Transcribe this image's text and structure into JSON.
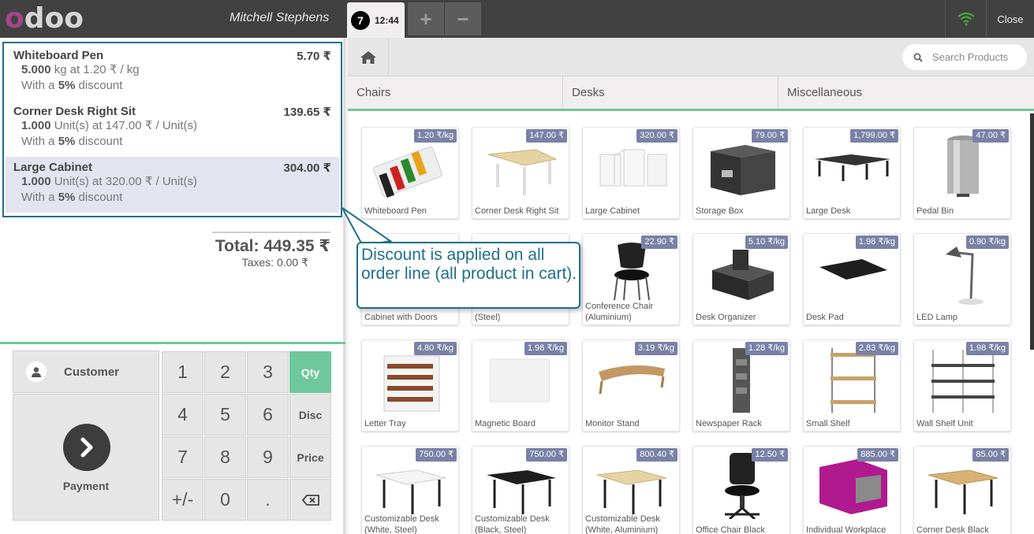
{
  "header": {
    "user": "Mitchell Stephens",
    "order_number": "7",
    "order_time": "12:44",
    "add_label": "+",
    "remove_label": "−",
    "close_label": "Close"
  },
  "order": {
    "lines": [
      {
        "name": "Whiteboard Pen",
        "price": "5.70 ₹",
        "qty": "5.000",
        "unit_text": " kg at 1.20 ₹ / kg",
        "disc_pre": "With a ",
        "disc": "5%",
        "disc_post": " discount"
      },
      {
        "name": "Corner Desk Right Sit",
        "price": "139.65 ₹",
        "qty": "1.000",
        "unit_text": " Unit(s) at 147.00 ₹ / Unit(s)",
        "disc_pre": "With a ",
        "disc": "5%",
        "disc_post": " discount"
      },
      {
        "name": "Large Cabinet",
        "price": "304.00 ₹",
        "qty": "1.000",
        "unit_text": " Unit(s) at 320.00 ₹ / Unit(s)",
        "disc_pre": "With a ",
        "disc": "5%",
        "disc_post": " discount"
      }
    ],
    "total": "Total: 449.35 ₹",
    "taxes": "Taxes: 0.00 ₹"
  },
  "keypad": {
    "customer_label": "Customer",
    "payment_label": "Payment",
    "keys": [
      "1",
      "2",
      "3",
      "4",
      "5",
      "6",
      "7",
      "8",
      "9",
      "+/-",
      "0",
      "."
    ],
    "modes": [
      "Qty",
      "Disc",
      "Price"
    ]
  },
  "products_panel": {
    "search_placeholder": "Search Products",
    "categories": [
      "Chairs",
      "Desks",
      "Miscellaneous"
    ]
  },
  "products": [
    {
      "name": "Whiteboard Pen",
      "price": "1.20 ₹/kg"
    },
    {
      "name": "Corner Desk Right Sit",
      "price": "147.00 ₹"
    },
    {
      "name": "Large Cabinet",
      "price": "320.00 ₹"
    },
    {
      "name": "Storage Box",
      "price": "79.00 ₹"
    },
    {
      "name": "Large Desk",
      "price": "1,799.00 ₹"
    },
    {
      "name": "Pedal Bin",
      "price": "47.00 ₹"
    },
    {
      "name": "Cabinet with Doors",
      "price": ""
    },
    {
      "name": "(Steel)",
      "price": ""
    },
    {
      "name": "Conference Chair (Aluminium)",
      "price": "22.90 ₹"
    },
    {
      "name": "Desk Organizer",
      "price": "5.10 ₹/kg"
    },
    {
      "name": "Desk Pad",
      "price": "1.98 ₹/kg"
    },
    {
      "name": "LED Lamp",
      "price": "0.90 ₹/kg"
    },
    {
      "name": "Letter Tray",
      "price": "4.80 ₹/kg"
    },
    {
      "name": "Magnetic Board",
      "price": "1.98 ₹/kg"
    },
    {
      "name": "Monitor Stand",
      "price": "3.19 ₹/kg"
    },
    {
      "name": "Newspaper Rack",
      "price": "1.28 ₹/kg"
    },
    {
      "name": "Small Shelf",
      "price": "2.83 ₹/kg"
    },
    {
      "name": "Wall Shelf Unit",
      "price": "1.98 ₹/kg"
    },
    {
      "name": "Customizable Desk (White, Steel)",
      "price": "750.00 ₹"
    },
    {
      "name": "Customizable Desk (Black, Steel)",
      "price": "750.00 ₹"
    },
    {
      "name": "Customizable Desk (White, Aluminium)",
      "price": "800.40 ₹"
    },
    {
      "name": "Office Chair Black",
      "price": "12.50 ₹"
    },
    {
      "name": "Individual Workplace",
      "price": "885.00 ₹"
    },
    {
      "name": "Corner Desk Black",
      "price": "85.00 ₹"
    }
  ],
  "callout": {
    "text": "Discount is applied on all order line (all product in cart)."
  }
}
